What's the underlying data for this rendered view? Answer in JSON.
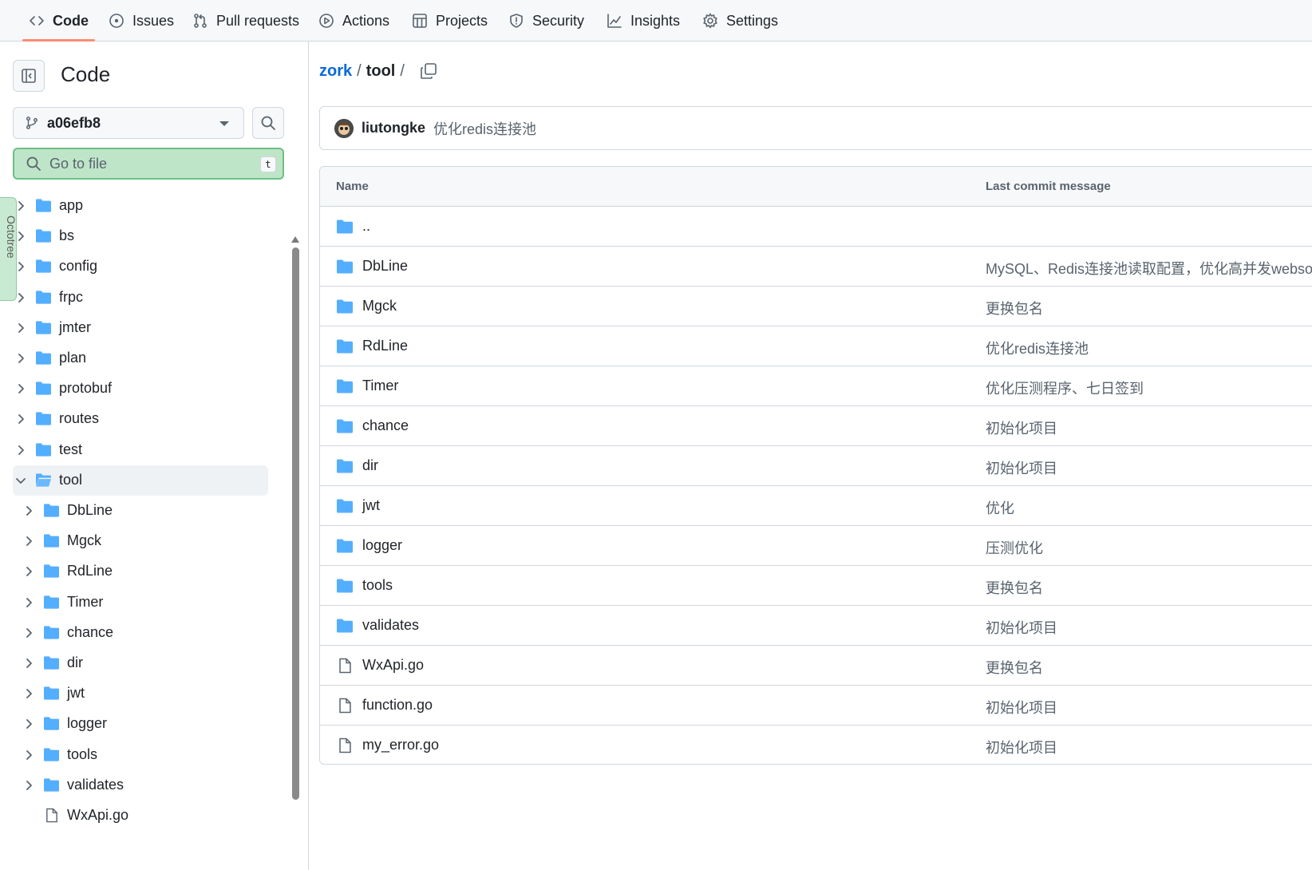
{
  "colors": {
    "accent_underline": "#fd8c73",
    "folder": "#54aeff",
    "link": "#0969da",
    "goto_bg": "#bfe5c8"
  },
  "nav": {
    "tabs": [
      {
        "label": "Code",
        "icon": "code-icon"
      },
      {
        "label": "Issues",
        "icon": "issue-icon"
      },
      {
        "label": "Pull requests",
        "icon": "pull-request-icon"
      },
      {
        "label": "Actions",
        "icon": "play-icon"
      },
      {
        "label": "Projects",
        "icon": "table-icon"
      },
      {
        "label": "Security",
        "icon": "shield-icon"
      },
      {
        "label": "Insights",
        "icon": "graph-icon"
      },
      {
        "label": "Settings",
        "icon": "gear-icon"
      }
    ],
    "active": "Code"
  },
  "sidebar": {
    "title": "Code",
    "branch": "a06efb8",
    "go_to_file": "Go to file",
    "go_to_file_key": "t",
    "octotree_label": "Octotree",
    "tree": [
      {
        "label": "app",
        "type": "folder",
        "depth": 0,
        "expanded": false
      },
      {
        "label": "bs",
        "type": "folder",
        "depth": 0,
        "expanded": false
      },
      {
        "label": "config",
        "type": "folder",
        "depth": 0,
        "expanded": false
      },
      {
        "label": "frpc",
        "type": "folder",
        "depth": 0,
        "expanded": false
      },
      {
        "label": "jmter",
        "type": "folder",
        "depth": 0,
        "expanded": false
      },
      {
        "label": "plan",
        "type": "folder",
        "depth": 0,
        "expanded": false
      },
      {
        "label": "protobuf",
        "type": "folder",
        "depth": 0,
        "expanded": false
      },
      {
        "label": "routes",
        "type": "folder",
        "depth": 0,
        "expanded": false
      },
      {
        "label": "test",
        "type": "folder",
        "depth": 0,
        "expanded": false
      },
      {
        "label": "tool",
        "type": "folder",
        "depth": 0,
        "expanded": true,
        "selected": true
      },
      {
        "label": "DbLine",
        "type": "folder",
        "depth": 1,
        "expanded": false
      },
      {
        "label": "Mgck",
        "type": "folder",
        "depth": 1,
        "expanded": false
      },
      {
        "label": "RdLine",
        "type": "folder",
        "depth": 1,
        "expanded": false
      },
      {
        "label": "Timer",
        "type": "folder",
        "depth": 1,
        "expanded": false
      },
      {
        "label": "chance",
        "type": "folder",
        "depth": 1,
        "expanded": false
      },
      {
        "label": "dir",
        "type": "folder",
        "depth": 1,
        "expanded": false
      },
      {
        "label": "jwt",
        "type": "folder",
        "depth": 1,
        "expanded": false
      },
      {
        "label": "logger",
        "type": "folder",
        "depth": 1,
        "expanded": false
      },
      {
        "label": "tools",
        "type": "folder",
        "depth": 1,
        "expanded": false
      },
      {
        "label": "validates",
        "type": "folder",
        "depth": 1,
        "expanded": false
      },
      {
        "label": "WxApi.go",
        "type": "file",
        "depth": 1
      }
    ]
  },
  "breadcrumb": {
    "repo": "zork",
    "dir": "tool",
    "sep": "/"
  },
  "latest_commit": {
    "author": "liutongke",
    "message": "优化redis连接池"
  },
  "files": {
    "headers": {
      "name": "Name",
      "last_commit": "Last commit message"
    },
    "rows": [
      {
        "name": "..",
        "type": "parent",
        "message": ""
      },
      {
        "name": "DbLine",
        "type": "folder",
        "message": "MySQL、Redis连接池读取配置，优化高并发websocket"
      },
      {
        "name": "Mgck",
        "type": "folder",
        "message": "更换包名"
      },
      {
        "name": "RdLine",
        "type": "folder",
        "message": "优化redis连接池"
      },
      {
        "name": "Timer",
        "type": "folder",
        "message": "优化压测程序、七日签到"
      },
      {
        "name": "chance",
        "type": "folder",
        "message": "初始化项目"
      },
      {
        "name": "dir",
        "type": "folder",
        "message": "初始化项目"
      },
      {
        "name": "jwt",
        "type": "folder",
        "message": "优化"
      },
      {
        "name": "logger",
        "type": "folder",
        "message": "压测优化"
      },
      {
        "name": "tools",
        "type": "folder",
        "message": "更换包名"
      },
      {
        "name": "validates",
        "type": "folder",
        "message": "初始化项目"
      },
      {
        "name": "WxApi.go",
        "type": "file",
        "message": "更换包名"
      },
      {
        "name": "function.go",
        "type": "file",
        "message": "初始化项目"
      },
      {
        "name": "my_error.go",
        "type": "file",
        "message": "初始化项目"
      }
    ]
  }
}
